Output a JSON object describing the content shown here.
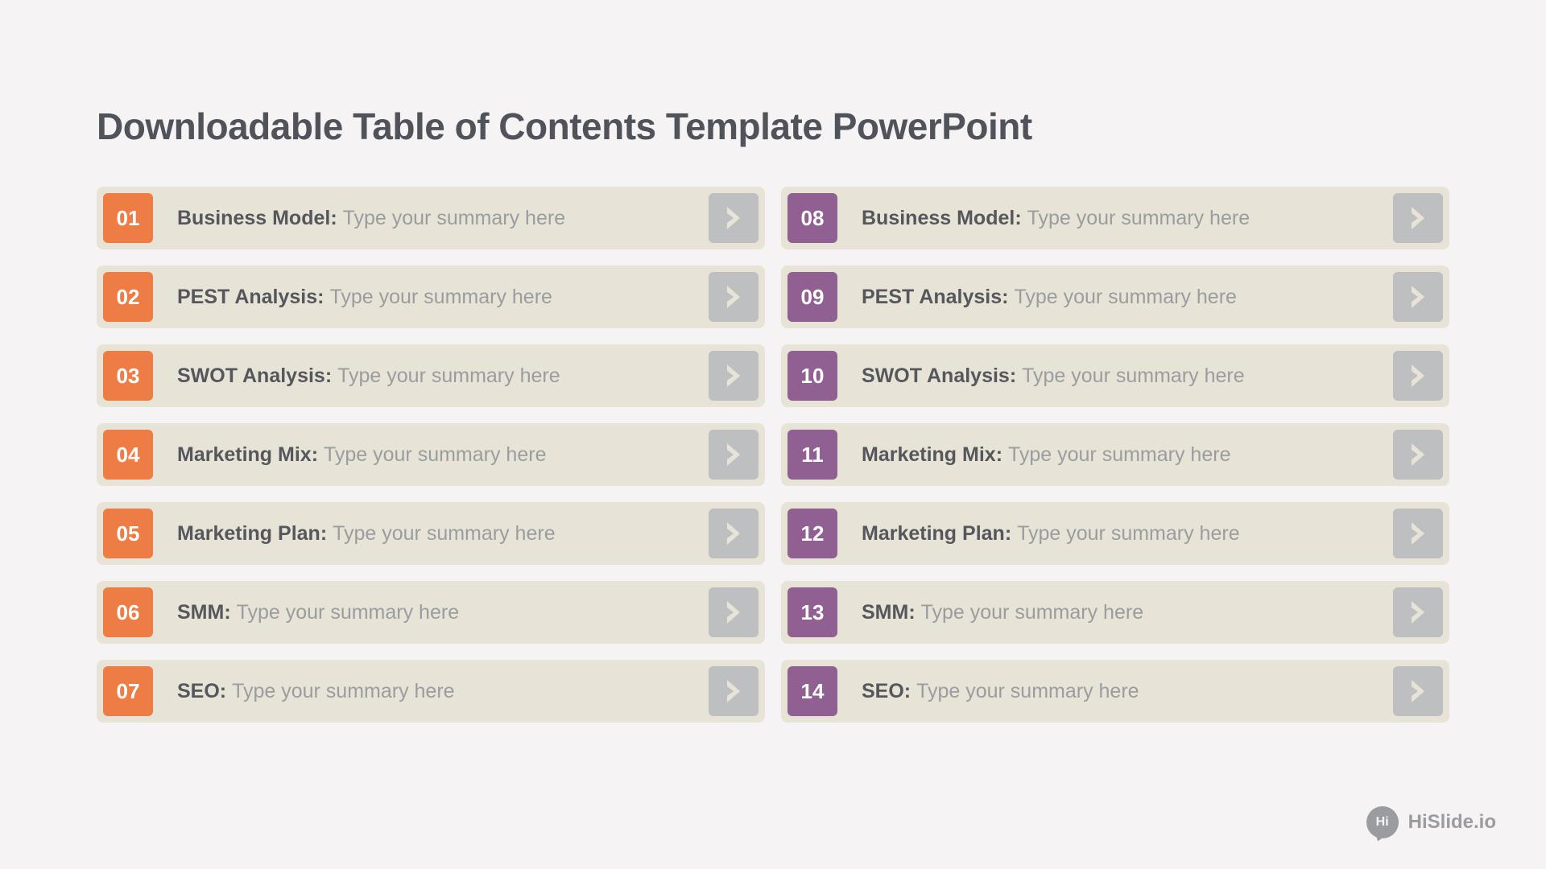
{
  "title": "Downloadable Table of Contents Template PowerPoint",
  "summary_placeholder": "Type your summary here",
  "colors": {
    "left": "#ed7d45",
    "right": "#916093",
    "row_bg": "#e7e4d7",
    "chev_bg": "#bdbfc1"
  },
  "left": [
    {
      "num": "01",
      "label": "Business Model:"
    },
    {
      "num": "02",
      "label": "PEST Analysis:"
    },
    {
      "num": "03",
      "label": "SWOT Analysis:"
    },
    {
      "num": "04",
      "label": "Marketing Mix:"
    },
    {
      "num": "05",
      "label": "Marketing Plan:"
    },
    {
      "num": "06",
      "label": "SMM:"
    },
    {
      "num": "07",
      "label": "SEO:"
    }
  ],
  "right": [
    {
      "num": "08",
      "label": "Business Model:"
    },
    {
      "num": "09",
      "label": "PEST Analysis:"
    },
    {
      "num": "10",
      "label": "SWOT Analysis:"
    },
    {
      "num": "11",
      "label": "Marketing Mix:"
    },
    {
      "num": "12",
      "label": "Marketing Plan:"
    },
    {
      "num": "13",
      "label": "SMM:"
    },
    {
      "num": "14",
      "label": "SEO:"
    }
  ],
  "brand": {
    "badge": "Hi",
    "name": "HiSlide.io"
  }
}
